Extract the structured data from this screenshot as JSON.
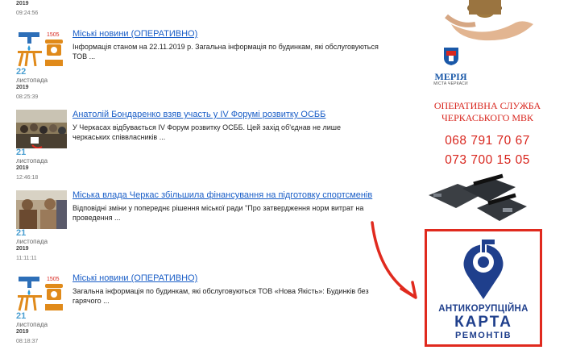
{
  "top_item": {
    "year": "2019",
    "time": "09:24:56"
  },
  "news": [
    {
      "title": "Міські новини (ОПЕРАТИВНО)",
      "excerpt": "Інформація станом на 22.11.2019 р. Загальна інформація по будинкам, які обслуговуються ТОВ ...",
      "day": "22",
      "month": "листопада",
      "year": "2019",
      "time": "08:25:39",
      "thumb_icon": "utility-services-icon",
      "thumb_code": "1505"
    },
    {
      "title": "Анатолій Бондаренко взяв участь у IV Форумі розвитку ОСББ",
      "excerpt": "У Черкасах відбувається IV Форум розвитку ОСББ. Цей захід об'єднав не лише черкаських співвласників ...",
      "day": "21",
      "month": "листопада",
      "year": "2019",
      "time": "12:46:18",
      "thumb_icon": "forum-photo"
    },
    {
      "title": "Міська влада Черкас збільшила фінансування на підготовку спортсменів",
      "excerpt": "Відповідні зміни у попереднє рішення міської ради \"Про затвердження норм витрат на проведення ...",
      "day": "21",
      "month": "листопада",
      "year": "2019",
      "time": "11:11:11",
      "thumb_icon": "sports-photo"
    },
    {
      "title": "Міські новини (ОПЕРАТИВНО)",
      "excerpt": "Загальна інформація по будинкам, які обслуговуються ТОВ «Нова Якість»: Будинків без гарячого ...",
      "day": "21",
      "month": "листопада",
      "year": "2019",
      "time": "08:18:37",
      "thumb_icon": "utility-services-icon",
      "thumb_code": "1505"
    }
  ],
  "sidebar": {
    "meria_name": "МЕРІЯ",
    "meria_sub": "МІСТА ЧЕРКАСИ",
    "service_line1": "ОПЕРАТИВНА СЛУЖБА",
    "service_line2": "ЧЕРКАСЬКОГО МВК",
    "phone1": "068 791 70 67",
    "phone2": "073 700 15 05",
    "banner_line1": "АНТИКОРУПЦІЙНА",
    "banner_line2": "КАРТА",
    "banner_line3": "РЕМОНТІВ"
  },
  "colors": {
    "link": "#1a5ec7",
    "date": "#4a9fd1",
    "accent_red": "#d8261e",
    "banner_blue": "#1f3f8c",
    "arrow": "#e02a1e"
  }
}
